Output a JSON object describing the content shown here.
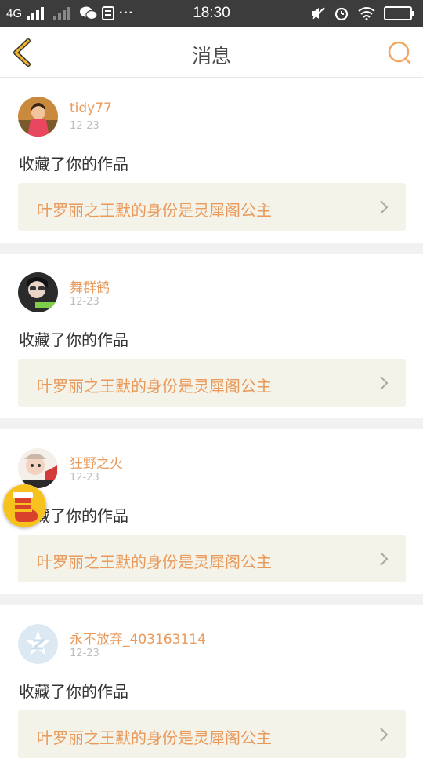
{
  "status_bar": {
    "network": "4G",
    "time": "18:30",
    "more": "···",
    "icons": [
      "signal-icon",
      "wechat-icon",
      "storage-icon",
      "mute-icon",
      "alarm-icon",
      "wifi-icon",
      "battery-icon"
    ]
  },
  "header": {
    "title": "消息",
    "back_icon": "chevron-left-icon",
    "search_icon": "search-icon",
    "accent": "#f0b429"
  },
  "notifications": [
    {
      "username": "tidy77",
      "date": "12-23",
      "action": "收藏了你的作品",
      "work_title": "叶罗丽之王默的身份是灵犀阁公主",
      "avatar": "user-photo-avatar"
    },
    {
      "username": "舞群鹤",
      "date": "12-23",
      "action": "收藏了你的作品",
      "work_title": "叶罗丽之王默的身份是灵犀阁公主",
      "avatar": "user-photo-avatar"
    },
    {
      "username": "狂野之火",
      "date": "12-23",
      "action": "收藏了你的作品",
      "work_title": "叶罗丽之王默的身份是灵犀阁公主",
      "avatar": "user-photo-avatar"
    },
    {
      "username": "永不放弃_403163114",
      "date": "12-23",
      "action": "收藏了你的作品",
      "work_title": "叶罗丽之王默的身份是灵犀阁公主",
      "avatar": "default-avatar-icon"
    }
  ],
  "floating_badge": {
    "icon": "stocking-icon"
  },
  "colors": {
    "username": "#e99a5b",
    "work_title": "#e99a5b",
    "link_bg": "#f4f3e9"
  }
}
